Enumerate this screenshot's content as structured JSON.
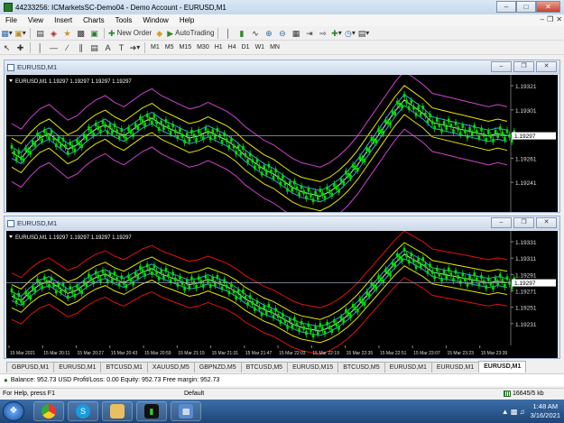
{
  "window": {
    "title": "44233256: ICMarketsSC-Demo04 - Demo Account - EURUSD,M1"
  },
  "menu": [
    "File",
    "View",
    "Insert",
    "Charts",
    "Tools",
    "Window",
    "Help"
  ],
  "toolbar": {
    "new_order_label": "New Order",
    "autotrading_label": "AutoTrading",
    "timeframes": [
      "M1",
      "M5",
      "M15",
      "M30",
      "H1",
      "H4",
      "D1",
      "W1",
      "MN"
    ]
  },
  "charts": [
    {
      "window_title": "EURUSD,M1",
      "info_line": "EURUSD,M1  1.19297 1.19297 1.19297 1.19297",
      "price_labels": [
        "1.19321",
        "1.19301",
        "1.19281",
        "1.19261",
        "1.19241"
      ],
      "current_price": "1.19297",
      "price_min": 1.1922,
      "price_max": 1.1935,
      "band_color_outer": "#cc44cc"
    },
    {
      "window_title": "EURUSD,M1",
      "info_line": "EURUSD,M1  1.19297 1.19297 1.19297 1.19297",
      "price_labels": [
        "1.19331",
        "1.19311",
        "1.19291",
        "1.19271",
        "1.19251",
        "1.19231"
      ],
      "current_price": "1.19297",
      "price_min": 1.1922,
      "price_max": 1.1935,
      "band_color_outer": "#dd1111",
      "time_labels": [
        "15 Mar 2021",
        "15 Mar 20:11",
        "15 Mar 20:27",
        "15 Mar 20:43",
        "15 Mar 20:59",
        "15 Mar 21:15",
        "15 Mar 21:31",
        "15 Mar 21:47",
        "15 Mar 22:03",
        "15 Mar 22:19",
        "15 Mar 22:35",
        "15 Mar 22:51",
        "15 Mar 23:07",
        "15 Mar 23:23",
        "15 Mar 23:39"
      ]
    }
  ],
  "tabs": [
    "GBPUSD,M1",
    "EURUSD,M1",
    "BTCUSD,M1",
    "XAUUSD,M5",
    "GBPNZD,M5",
    "BTCUSD,M5",
    "EURUSD,M15",
    "BTCUSD,M5",
    "EURUSD,M1",
    "EURUSD,M1",
    "EURUSD,M1"
  ],
  "active_tab_index": 10,
  "terminal": {
    "balance_line": "Balance: 952.73 USD  Profit/Loss: 0.00  Equity: 952.73  Free margin: 952.73"
  },
  "status": {
    "help": "For Help, press F1",
    "profile": "Default",
    "traffic": "16645/5 kb"
  },
  "taskbar": {
    "time": "1:48 AM",
    "date": "3/16/2021"
  },
  "colors": {
    "candle": "#00dd00",
    "ma_yellow": "#e6e600",
    "ma_cyan": "#33aadd",
    "ma_white": "#dddddd",
    "grid_line": "#9aa4b8"
  }
}
